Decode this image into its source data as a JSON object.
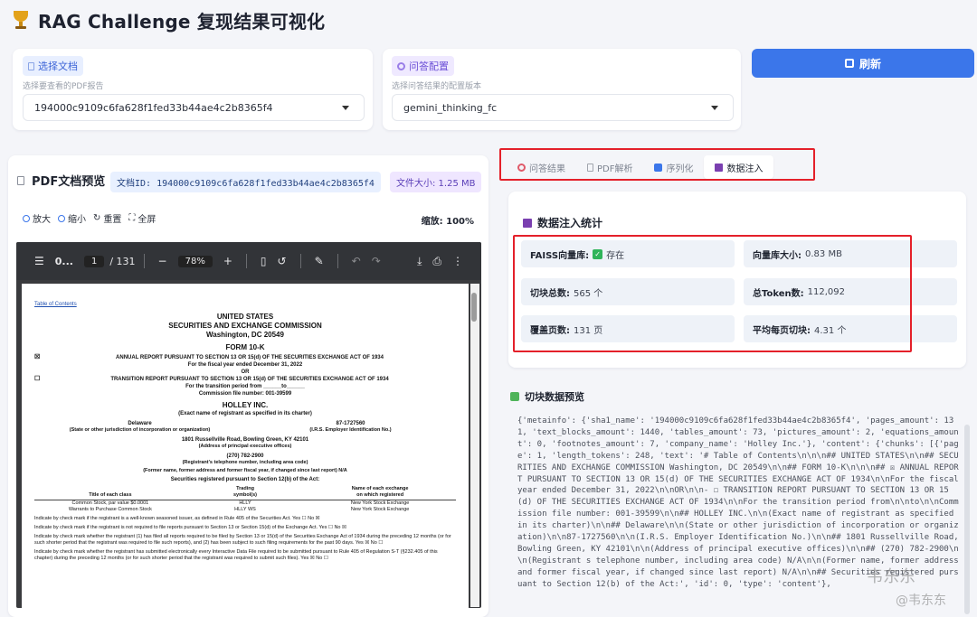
{
  "header": {
    "title": "RAG Challenge 复现结果可视化"
  },
  "doc_select": {
    "label": "选择文档",
    "hint": "选择要查看的PDF报告",
    "value": "194000c9109c6fa628f1fed33b44ae4c2b8365f4"
  },
  "config_select": {
    "label": "问答配置",
    "hint": "选择问答结果的配置版本",
    "value": "gemini_thinking_fc"
  },
  "refresh_button": {
    "label": "刷新"
  },
  "pdf_panel": {
    "title": "PDF文档预览",
    "doc_id": "文档ID: 194000c9109c6fa628f1fed33b44ae4c2b8365f4",
    "file_size": "文件大小: 1.25 MB",
    "zoom_in": "放大",
    "zoom_out": "缩小",
    "reset": "重置",
    "fullscreen": "全屏",
    "zoom_level": "缩放: 100%"
  },
  "viewer": {
    "title_short": "0...",
    "page_current": "1",
    "page_total": "/ 131",
    "zoom": "78%"
  },
  "pdf_page": {
    "toc": "Table of Contents",
    "h1": "UNITED STATES",
    "h2": "SECURITIES AND EXCHANGE COMMISSION",
    "h3": "Washington, DC 20549",
    "form": "FORM 10-K",
    "check1": "☒",
    "annual": "ANNUAL REPORT PURSUANT TO SECTION 13 OR 15(d) OF THE SECURITIES EXCHANGE ACT OF 1934",
    "fiscal": "For the fiscal year ended December 31, 2022",
    "or1": "OR",
    "check2": "☐",
    "transition": "TRANSITION REPORT PURSUANT TO SECTION 13 OR 15(d) OF THE SECURITIES EXCHANGE ACT OF 1934",
    "trans_period": "For the transition period from ______to______",
    "commission": "Commission file number: 001-39599",
    "company": "HOLLEY INC.",
    "company_sub": "(Exact name of registrant as specified in its charter)",
    "state": "Delaware",
    "state_sub": "(State or other jurisdiction of incorporation or organization)",
    "ein": "87-1727560",
    "ein_sub": "(I.R.S. Employer Identification No.)",
    "address": "1801 Russellville Road, Bowling Green, KY 42101",
    "address_sub": "(Address of principal executive offices)",
    "phone": "(270) 782-2900",
    "phone_sub": "(Registrant's telephone number, including area code)",
    "former": "(Former name, former address and former fiscal year, if changed since last report) N/A",
    "registered": "Securities registered pursuant to Section 12(b) of the Act:",
    "col1": "Title of each class",
    "col2": "Trading symbol(s)",
    "col2a": "Trading",
    "col2b": "symbol(s)",
    "col3a": "Name of each exchange",
    "col3b": "on which registered",
    "r1c1": "Common Stock, par value $0.0001",
    "r1c2": "HLLY",
    "r1c3": "New York Stock Exchange",
    "r2c1": "Warrants to Purchase Common Stock",
    "r2c2": "HLLY WS",
    "r2c3": "New York Stock Exchange",
    "l1": "Indicate by check mark if the registrant is a well-known seasoned issuer, as defined in Rule 405 of the Securities Act. Yes ☐ No ☒",
    "l2": "Indicate by check mark if the registrant is not required to file reports pursuant to Section 13 or Section 15(d) of the Exchange Act. Yes ☐ No ☒",
    "l3": "Indicate by check mark whether the registrant (1) has filed all reports required to be filed by Section 13 or 15(d) of the Securities Exchange Act of 1934 during the preceding 12 months (or for such shorter period that the registrant was required to file such reports), and (2) has been subject to such filing requirements for the past 90 days. Yes ☒ No ☐",
    "l4": "Indicate by check mark whether the registrant has submitted electronically every Interactive Data File required to be submitted pursuant to Rule 405 of Regulation S-T (§232.405 of this chapter) during the preceding 12 months (or for such shorter period that the registrant was required to submit such files). Yes ☒ No ☐"
  },
  "tabs": [
    {
      "label": "问答结果"
    },
    {
      "label": "PDF解析"
    },
    {
      "label": "序列化"
    },
    {
      "label": "数据注入"
    }
  ],
  "injection": {
    "title": "数据注入统计",
    "stats": [
      {
        "key": "FAISS向量库:",
        "value": "存在"
      },
      {
        "key": "向量库大小:",
        "value": "0.83 MB"
      },
      {
        "key": "切块总数:",
        "value": "565 个"
      },
      {
        "key": "总Token数:",
        "value": "112,092"
      },
      {
        "key": "覆盖页数:",
        "value": "131 页"
      },
      {
        "key": "平均每页切块:",
        "value": "4.31 个"
      }
    ]
  },
  "chunks": {
    "title": "切块数据预览",
    "text": "{'metainfo': {'sha1_name': '194000c9109c6fa628f1fed33b44ae4c2b8365f4', 'pages_amount': 131, 'text_blocks_amount': 1440, 'tables_amount': 73, 'pictures_amount': 2, 'equations_amount': 0, 'footnotes_amount': 7, 'company_name': 'Holley Inc.'}, 'content': {'chunks': [{'page': 1, 'length_tokens': 248, 'text': '# Table of Contents\\n\\n\\n## UNITED STATES\\n\\n## SECURITIES AND EXCHANGE COMMISSION Washington, DC 20549\\n\\n## FORM 10-K\\n\\n\\n## ☒ ANNUAL REPORT PURSUANT TO SECTION 13 OR 15(d) OF THE SECURITIES EXCHANGE ACT OF 1934\\n\\nFor the fiscal year ended December 31, 2022\\n\\nOR\\n\\n- ☐ TRANSITION REPORT PURSUANT TO SECTION 13 OR 15(d) OF THE SECURITIES EXCHANGE ACT OF 1934\\n\\nFor the transition period from\\n\\nto\\n\\nCommission file number: 001-39599\\n\\n## HOLLEY INC.\\n\\n(Exact name of registrant as specified in its charter)\\n\\n## Delaware\\n\\n(State or other jurisdiction of incorporation or organization)\\n\\n87-1727560\\n\\n(I.R.S. Employer Identification No.)\\n\\n## 1801 Russellville Road, Bowling Green, KY 42101\\n\\n(Address of principal executive offices)\\n\\n## (270) 782-2900\\n\\n(Registrant s telephone number, including area code) N/A\\n\\n(Former name, former address and former fiscal year, if changed since last report) N/A\\n\\n## Securities registered pursuant to Section 12(b) of the Act:', 'id': 0, 'type': 'content'},"
  },
  "watermark": {
    "text1": "韦东东",
    "text2": "@韦东东"
  }
}
